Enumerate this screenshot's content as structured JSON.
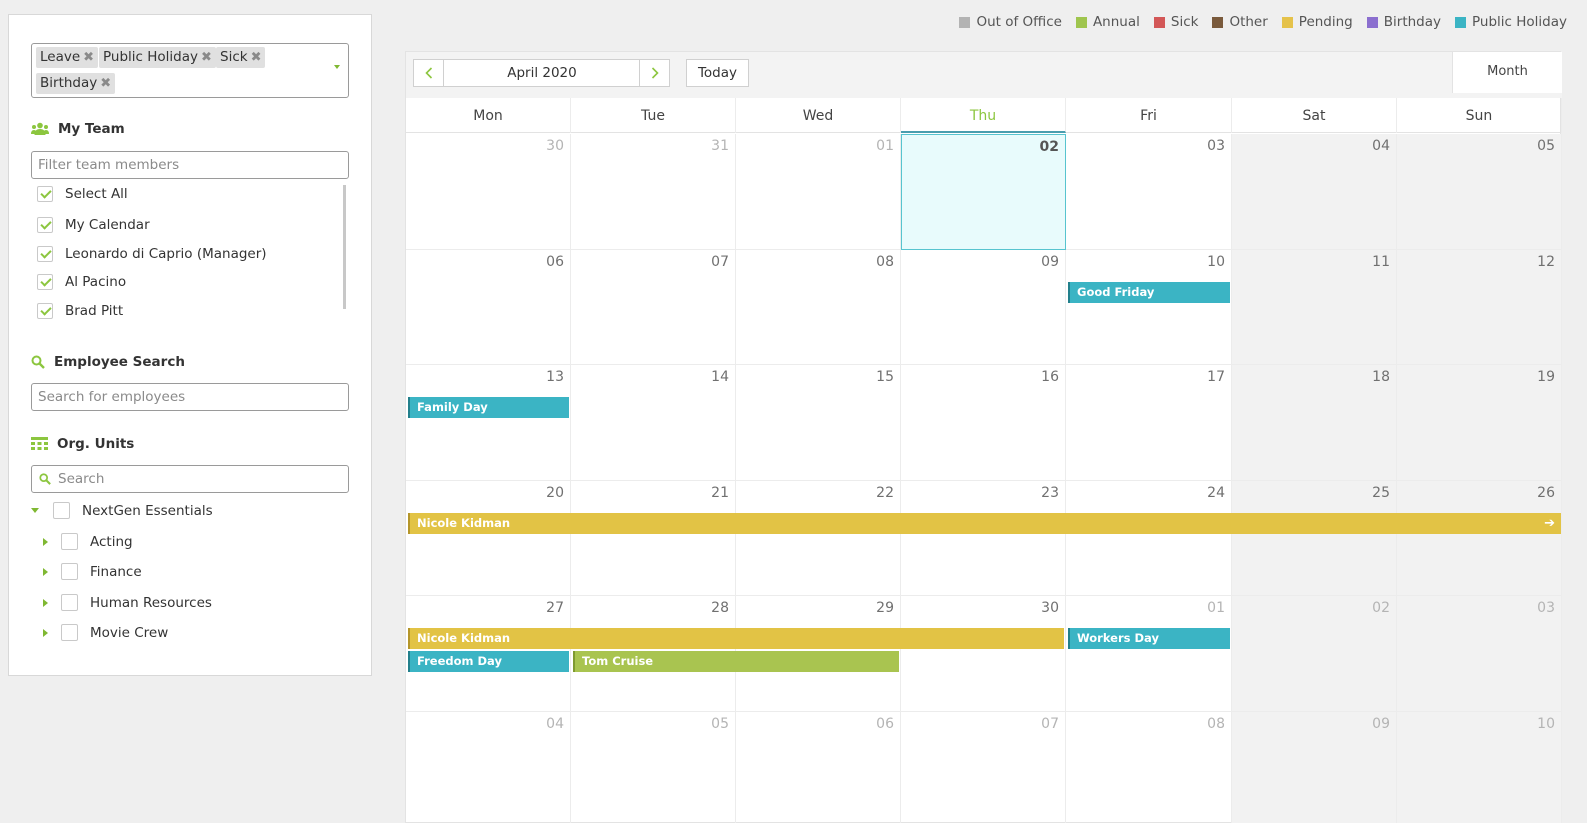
{
  "filters": {
    "tags": [
      "Leave",
      "Public Holiday",
      "Sick",
      "Birthday"
    ]
  },
  "team": {
    "heading": "My Team",
    "filter_placeholder": "Filter team members",
    "select_all": "Select All",
    "members": [
      "My Calendar",
      "Leonardo di Caprio (Manager)",
      "Al Pacino",
      "Brad Pitt"
    ]
  },
  "employee_search": {
    "heading": "Employee Search",
    "placeholder": "Search for employees"
  },
  "org_units": {
    "heading": "Org. Units",
    "placeholder": "Search",
    "root": "NextGen Essentials",
    "children": [
      "Acting",
      "Finance",
      "Human Resources",
      "Movie Crew"
    ]
  },
  "legend": [
    {
      "label": "Out of Office",
      "color": "#b3b3b3"
    },
    {
      "label": "Annual",
      "color": "#9fc54e"
    },
    {
      "label": "Sick",
      "color": "#d35757"
    },
    {
      "label": "Other",
      "color": "#7a5a3c"
    },
    {
      "label": "Pending",
      "color": "#e5c24a"
    },
    {
      "label": "Birthday",
      "color": "#8b6fcf"
    },
    {
      "label": "Public Holiday",
      "color": "#3bb4c4"
    }
  ],
  "toolbar": {
    "month_label": "April 2020",
    "today_label": "Today",
    "view_label": "Month"
  },
  "weekdays": [
    "Mon",
    "Tue",
    "Wed",
    "Thu",
    "Fri",
    "Sat",
    "Sun"
  ],
  "today_col": 3,
  "weeks": [
    [
      "30",
      "31",
      "01",
      "02",
      "03",
      "04",
      "05"
    ],
    [
      "06",
      "07",
      "08",
      "09",
      "10",
      "11",
      "12"
    ],
    [
      "13",
      "14",
      "15",
      "16",
      "17",
      "18",
      "19"
    ],
    [
      "20",
      "21",
      "22",
      "23",
      "24",
      "25",
      "26"
    ],
    [
      "27",
      "28",
      "29",
      "30",
      "01",
      "02",
      "03"
    ],
    [
      "04",
      "05",
      "06",
      "07",
      "08",
      "09",
      "10"
    ]
  ],
  "events": [
    {
      "label": "Good Friday",
      "week": 1,
      "start": 4,
      "span": 1,
      "lane": 0,
      "color": "teal"
    },
    {
      "label": "Family Day",
      "week": 2,
      "start": 0,
      "span": 1,
      "lane": 0,
      "color": "teal"
    },
    {
      "label": "Nicole Kidman",
      "week": 3,
      "start": 0,
      "span": 7,
      "lane": 0,
      "color": "yellow",
      "continues": true
    },
    {
      "label": "Nicole Kidman",
      "week": 4,
      "start": 0,
      "span": 4,
      "lane": 0,
      "color": "yellow"
    },
    {
      "label": "Workers Day",
      "week": 4,
      "start": 4,
      "span": 1,
      "lane": 0,
      "color": "teal"
    },
    {
      "label": "Freedom Day",
      "week": 4,
      "start": 0,
      "span": 1,
      "lane": 1,
      "color": "teal"
    },
    {
      "label": "Tom Cruise",
      "week": 4,
      "start": 1,
      "span": 2,
      "lane": 1,
      "color": "green"
    }
  ]
}
